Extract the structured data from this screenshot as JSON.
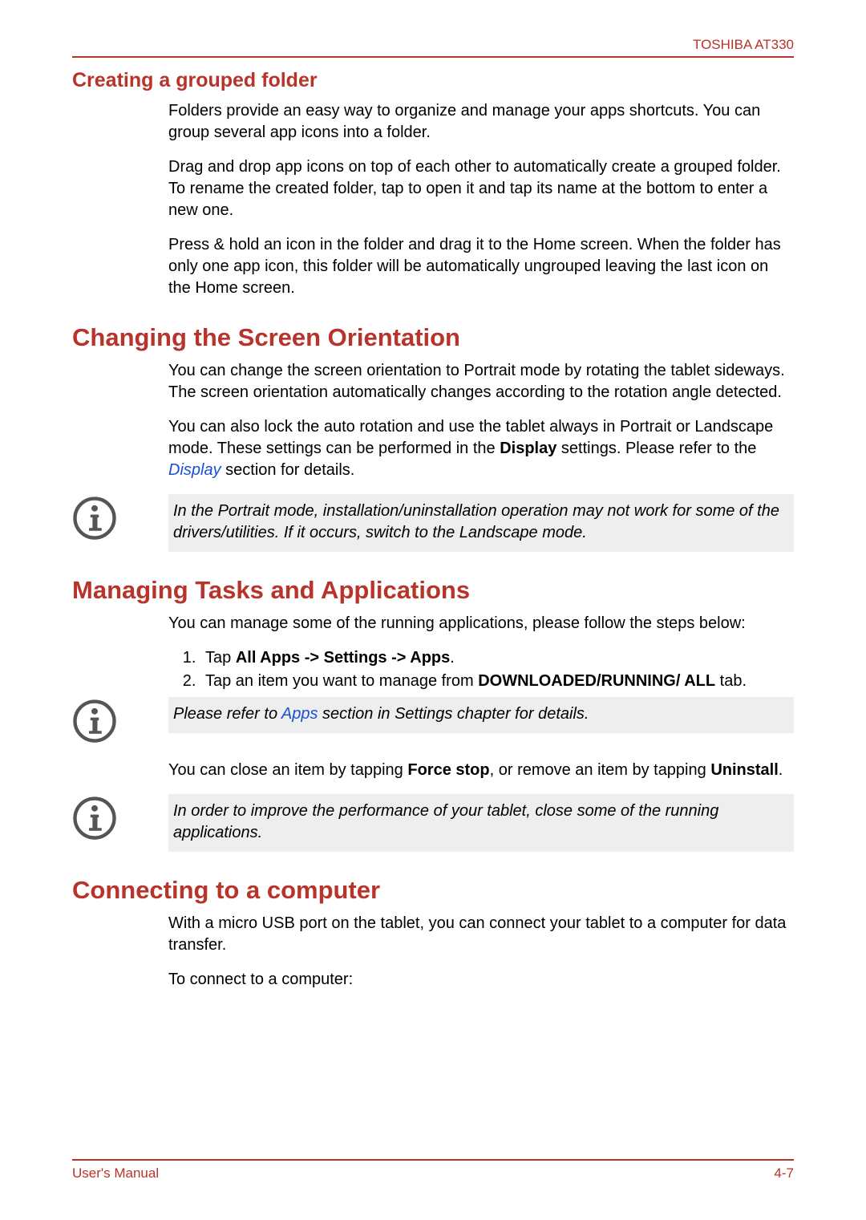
{
  "header": {
    "product": "TOSHIBA AT330"
  },
  "section_folder": {
    "title": "Creating a grouped folder",
    "p1": "Folders provide an easy way to organize and manage your apps shortcuts. You can group several app icons into a folder.",
    "p2": "Drag and drop app icons on top of each other to automatically create a grouped folder. To rename the created folder, tap to open it and tap its name at the bottom to enter a new one.",
    "p3": "Press & hold an icon in the folder and drag it to the Home screen. When the folder has only one app icon, this folder will be automatically ungrouped leaving the last icon on the Home screen."
  },
  "section_orientation": {
    "title": "Changing the Screen Orientation",
    "p1": "You can change the screen orientation to Portrait mode by rotating the tablet sideways. The screen orientation automatically changes according to the rotation angle detected.",
    "p2_pre": "You can also lock the auto rotation and use the tablet always in Portrait or Landscape mode. These settings can be performed in the ",
    "p2_bold": "Display",
    "p2_mid": " settings. Please refer to the ",
    "p2_link": "Display",
    "p2_post": " section for details.",
    "note": "In the Portrait mode, installation/uninstallation operation may not work for some of the drivers/utilities. If it occurs, switch to the Landscape mode."
  },
  "section_tasks": {
    "title": "Managing Tasks and Applications",
    "p1": "You can manage some of the running applications, please follow the steps below:",
    "step1_pre": "Tap ",
    "step1_bold": "All Apps -> Settings -> Apps",
    "step1_post": ".",
    "step2_pre": "Tap an item you want to manage from ",
    "step2_bold": "DOWNLOADED/RUNNING/ ALL",
    "step2_post": " tab.",
    "note1_pre": "Please refer to ",
    "note1_link": "Apps",
    "note1_post": " section in Settings chapter for details.",
    "p2_pre": "You can close an item by tapping ",
    "p2_b1": "Force stop",
    "p2_mid": ", or remove an item by tapping ",
    "p2_b2": "Uninstall",
    "p2_post": ".",
    "note2": "In order to improve the performance of your tablet, close some of the running applications."
  },
  "section_connect": {
    "title": "Connecting to a computer",
    "p1": "With a micro USB port on the tablet, you can connect your tablet to a computer for data transfer.",
    "p2": "To connect to a computer:"
  },
  "footer": {
    "left": "User's Manual",
    "right": "4-7"
  }
}
